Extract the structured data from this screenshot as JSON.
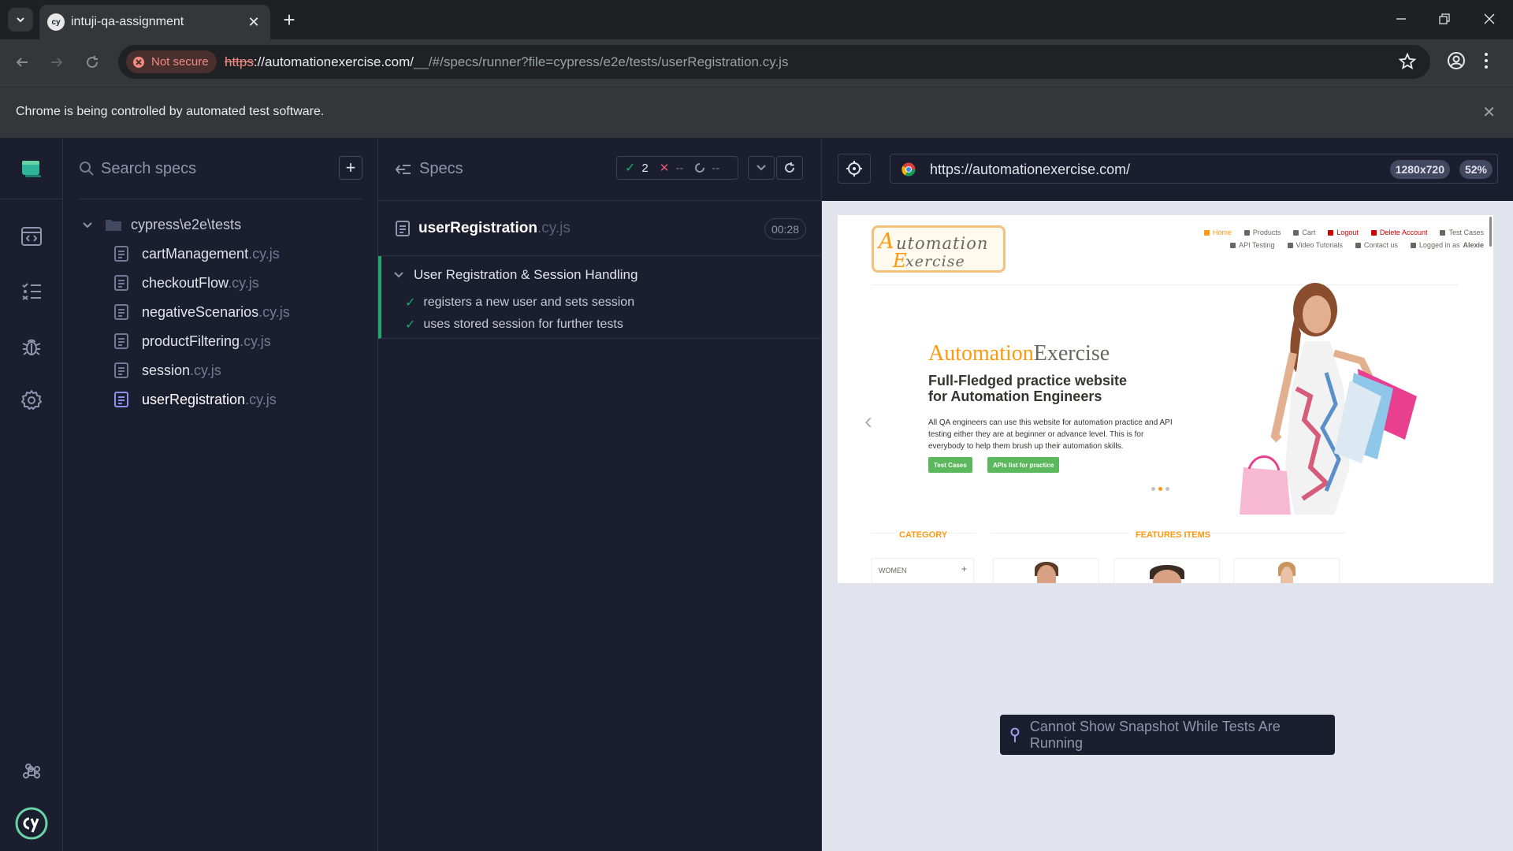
{
  "browser": {
    "tab_title": "intuji-qa-assignment",
    "not_secure_label": "Not secure",
    "url_scheme": "https",
    "url_host": "://automationexercise.com/",
    "url_path": "__/#/specs/runner?file=cypress/e2e/tests/userRegistration.cy.js",
    "infobar_text": "Chrome is being controlled by automated test software."
  },
  "nav_rail": {
    "items": [
      "specs",
      "runs",
      "debug",
      "settings"
    ],
    "active": "settings"
  },
  "specs_panel": {
    "search_placeholder": "Search specs",
    "folder": "cypress\\e2e\\tests",
    "specs": [
      {
        "name": "cartManagement",
        "ext": ".cy.js"
      },
      {
        "name": "checkoutFlow",
        "ext": ".cy.js"
      },
      {
        "name": "negativeScenarios",
        "ext": ".cy.js"
      },
      {
        "name": "productFiltering",
        "ext": ".cy.js"
      },
      {
        "name": "session",
        "ext": ".cy.js"
      },
      {
        "name": "userRegistration",
        "ext": ".cy.js"
      }
    ],
    "active_spec": "userRegistration"
  },
  "reporter": {
    "specs_label": "Specs",
    "passed": "2",
    "failed": "--",
    "pending": "--",
    "spec_name": "userRegistration",
    "spec_ext": ".cy.js",
    "duration": "00:28",
    "suite_title": "User Registration & Session Handling",
    "tests": [
      {
        "title": "registers a new user and sets session",
        "state": "passed"
      },
      {
        "title": "uses stored session for further tests",
        "state": "passed"
      }
    ]
  },
  "aut": {
    "url": "https://automationexercise.com/",
    "viewport": "1280x720",
    "zoom": "52%",
    "snapshot_message": "Cannot Show Snapshot While Tests Are Running"
  },
  "site": {
    "logo_line1_first": "A",
    "logo_line1_rest": "utomation",
    "logo_line2_first": "E",
    "logo_line2_rest": "xercise",
    "nav_row1": [
      "Home",
      "Products",
      "Cart",
      "Logout",
      "Delete Account",
      "Test Cases"
    ],
    "nav_row2": [
      "API Testing",
      "Video Tutorials",
      "Contact us"
    ],
    "logged_in_prefix": "Logged in as",
    "logged_in_user": "Alexie",
    "hero_title_a": "Automation",
    "hero_title_b": "Exercise",
    "hero_subtitle": "Full-Fledged practice website for Automation Engineers",
    "hero_desc": "All QA engineers can use this website for automation practice and API testing either they are at beginner or advance level. This is for everybody to help them brush up their automation skills.",
    "btn_test_cases": "Test Cases",
    "btn_apis": "APIs list for practice",
    "category_title": "CATEGORY",
    "features_title": "FEATURES ITEMS",
    "category_women": "WOMEN",
    "category_plus": "+"
  },
  "colors": {
    "cypress_bg": "#1b1e2e",
    "pass_green": "#1fa971",
    "site_orange": "#fe980f",
    "site_green": "#5cb85c"
  }
}
